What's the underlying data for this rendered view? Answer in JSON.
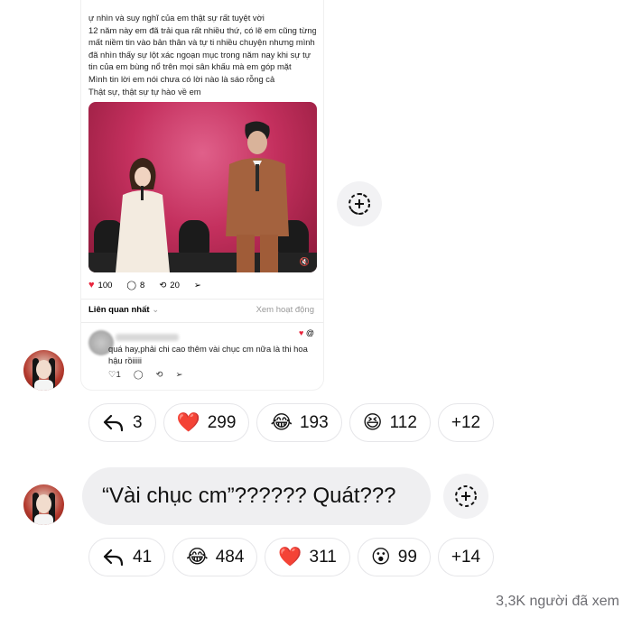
{
  "embedded_post": {
    "text_lines": [
      "ự nhìn và suy nghĩ của em thật sự rất tuyệt vời",
      "12 năm này em đã trải qua rất nhiều thứ, có lẽ em cũng từng",
      "mất niềm tin vào bản thân và tự ti nhiều chuyện nhưng mình",
      "đã nhìn thấy sự lột xác ngoạn mục trong năm nay khi sự tự",
      "tin của em bùng nổ trên mọi sân khấu mà em góp mặt",
      "Mình tin lời em nói chưa có lời nào là sáo rỗng cả",
      "Thật sự, thật sự tự hào về em"
    ],
    "likes": "100",
    "comments": "8",
    "reposts": "20",
    "related_label": "Liên quan nhất",
    "view_activity_label": "Xem hoạt động",
    "reply_text": "quá hay,phải chi cao thêm vài chục cm nữa là thi hoa hậu rồiiiii",
    "reply_likes": "1"
  },
  "messages": [
    {
      "reactions": [
        {
          "icon": "reply-arrow-icon",
          "emoji": "",
          "count": "3"
        },
        {
          "icon": "red-heart-icon",
          "emoji": "❤️",
          "count": "299"
        },
        {
          "icon": "laughing-tears-icon",
          "emoji": "😂",
          "count": "193"
        },
        {
          "icon": "squinting-laugh-icon",
          "emoji": "😆",
          "count": "112"
        },
        {
          "icon": "",
          "emoji": "",
          "count": "+12"
        }
      ]
    },
    {
      "text": "“Vài chục cm”?????? Quát???",
      "reactions": [
        {
          "icon": "reply-arrow-icon",
          "emoji": "",
          "count": "41"
        },
        {
          "icon": "laughing-tears-icon",
          "emoji": "😂",
          "count": "484"
        },
        {
          "icon": "red-heart-icon",
          "emoji": "❤️",
          "count": "311"
        },
        {
          "icon": "surprised-face-icon",
          "emoji": "😮",
          "count": "99"
        },
        {
          "icon": "",
          "emoji": "",
          "count": "+14"
        }
      ]
    }
  ],
  "seen_count": "3,3K người đã xem",
  "colors": {
    "heart": "#e8243c",
    "bubble": "#efeff1",
    "pill_border": "#e6e6e9",
    "seen_text": "#6d6d72"
  }
}
